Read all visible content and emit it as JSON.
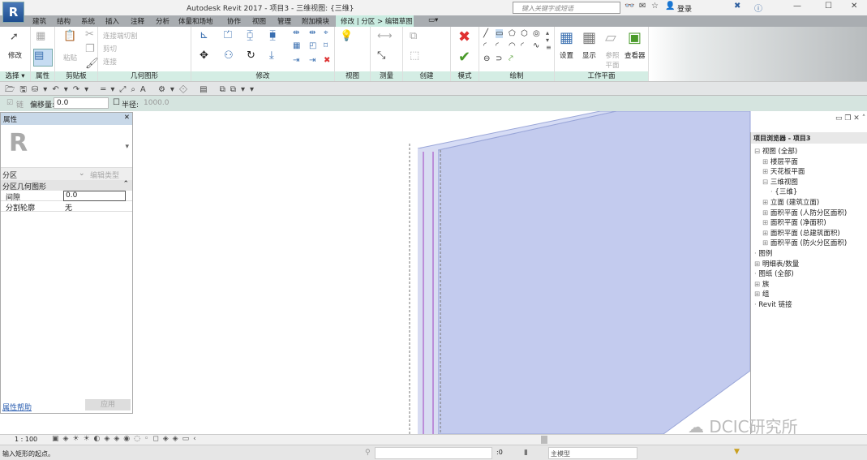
{
  "titlebar": {
    "app_button": "R",
    "title": "Autodesk Revit 2017 -     项目3 - 三维视图: {三维}",
    "search_placeholder": "键入关键字或短语",
    "login": "登录",
    "minimize": "—",
    "maximize": "☐",
    "close": "✕"
  },
  "tabs": [
    "建筑",
    "结构",
    "系统",
    "插入",
    "注释",
    "分析",
    "体量和场地",
    "协作",
    "视图",
    "管理",
    "附加模块"
  ],
  "active_tab": "修改 | 分区 > 编辑草图",
  "ribbon": {
    "modify_label": "修改",
    "panels": [
      "选择 ▾",
      "属性",
      "剪贴板",
      "几何图形",
      "修改",
      "视图",
      "测量",
      "创建",
      "模式",
      "绘制",
      "工作平面"
    ],
    "clipboard": {
      "paste": "粘贴"
    },
    "geometry": {
      "cut": "连接端切割",
      "cut2": "剪切",
      "join": "连接"
    },
    "workplane": {
      "set": "设置",
      "show": "显示",
      "ref": "参照平面",
      "viewer": "查看器"
    }
  },
  "options": {
    "chain_label": "链",
    "offset_label": "偏移量:",
    "offset_value": "0.0",
    "radius_label": "半径:",
    "radius_value": "1000.0"
  },
  "properties": {
    "title": "属性",
    "type": "分区",
    "edit_type": "编辑类型",
    "group": "分区几何图形",
    "rows": [
      {
        "name": "间隙",
        "value": "0.0"
      },
      {
        "name": "分割轮廓",
        "value": "无"
      }
    ],
    "help": "属性帮助",
    "apply": "应用"
  },
  "browser": {
    "title": "项目浏览器 - 项目3",
    "items": [
      {
        "label": "视图 (全部)",
        "level": 0,
        "toggle": "⊟"
      },
      {
        "label": "楼层平面",
        "level": 1,
        "toggle": "⊞"
      },
      {
        "label": "天花板平面",
        "level": 1,
        "toggle": "⊞"
      },
      {
        "label": "三维视图",
        "level": 1,
        "toggle": "⊟"
      },
      {
        "label": "{三维}",
        "level": 2,
        "toggle": ""
      },
      {
        "label": "立面 (建筑立面)",
        "level": 1,
        "toggle": "⊞"
      },
      {
        "label": "面积平面 (人防分区面积)",
        "level": 1,
        "toggle": "⊞"
      },
      {
        "label": "面积平面 (净面积)",
        "level": 1,
        "toggle": "⊞"
      },
      {
        "label": "面积平面 (总建筑面积)",
        "level": 1,
        "toggle": "⊞"
      },
      {
        "label": "面积平面 (防火分区面积)",
        "level": 1,
        "toggle": "⊞"
      },
      {
        "label": "图例",
        "level": 0,
        "toggle": ""
      },
      {
        "label": "明细表/数量",
        "level": 0,
        "toggle": "⊞"
      },
      {
        "label": "图纸 (全部)",
        "level": 0,
        "toggle": ""
      },
      {
        "label": "族",
        "level": 0,
        "toggle": "⊞"
      },
      {
        "label": "组",
        "level": 0,
        "toggle": "⊞"
      },
      {
        "label": "Revit 链接",
        "level": 0,
        "toggle": ""
      }
    ]
  },
  "viewbar": {
    "scale": "1 : 100"
  },
  "status": {
    "message": "输入矩形的起点。",
    "selection_count": ":0",
    "model": "主模型"
  },
  "watermark": "DCIC研究所",
  "colors": {
    "wall": "#c3cbee",
    "ribbon_label": "#d4ede4",
    "active_tab": "#c9ebe0"
  }
}
